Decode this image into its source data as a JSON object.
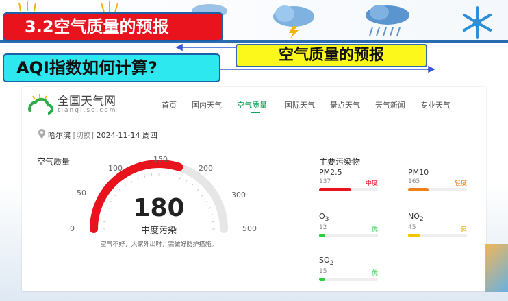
{
  "slide": {
    "title": "3.2空气质量的预报",
    "subtitle": "空气质量的预报",
    "question": "AQI指数如何计算?"
  },
  "weather_icons": [
    "sun-icon",
    "sun-icon",
    "cloud-icon",
    "thunder-cloud-icon",
    "rain-cloud-icon",
    "snowflake-icon"
  ],
  "site": {
    "logo_name": "全国天气网",
    "logo_domain": "tianqi.so.com",
    "nav": [
      "首页",
      "国内天气",
      "空气质量",
      "国际天气",
      "景点天气",
      "天气新闻",
      "专业天气"
    ],
    "active_nav": "空气质量"
  },
  "location": {
    "city": "哈尔滨",
    "switch": "[切换]",
    "date": "2024-11-14",
    "weekday": "周四"
  },
  "aqi": {
    "label": "空气质量",
    "value": 180,
    "value_text": "180",
    "level": "中度污染",
    "advice": "空气不好，大家外出时，需做好防护措施。",
    "scale_max": 500,
    "ticks": [
      "0",
      "50",
      "100",
      "150",
      "200",
      "300",
      "500"
    ],
    "color": "#e8131d"
  },
  "pollutants": {
    "title": "主要污染物",
    "items": [
      {
        "name": "PM2.5",
        "sub": "",
        "value": "137",
        "level": "中度",
        "fill": 0.55,
        "color": "#e8131d"
      },
      {
        "name": "PM10",
        "sub": "",
        "value": "165",
        "level": "轻度",
        "fill": 0.35,
        "color": "#f0801c"
      },
      {
        "name": "O",
        "sub": "3",
        "value": "12",
        "level": "优",
        "fill": 0.1,
        "color": "#2ecc40"
      },
      {
        "name": "NO",
        "sub": "2",
        "value": "45",
        "level": "良",
        "fill": 0.2,
        "color": "#f5c400"
      },
      {
        "name": "SO",
        "sub": "2",
        "value": "15",
        "level": "优",
        "fill": 0.1,
        "color": "#2ecc40"
      }
    ]
  }
}
